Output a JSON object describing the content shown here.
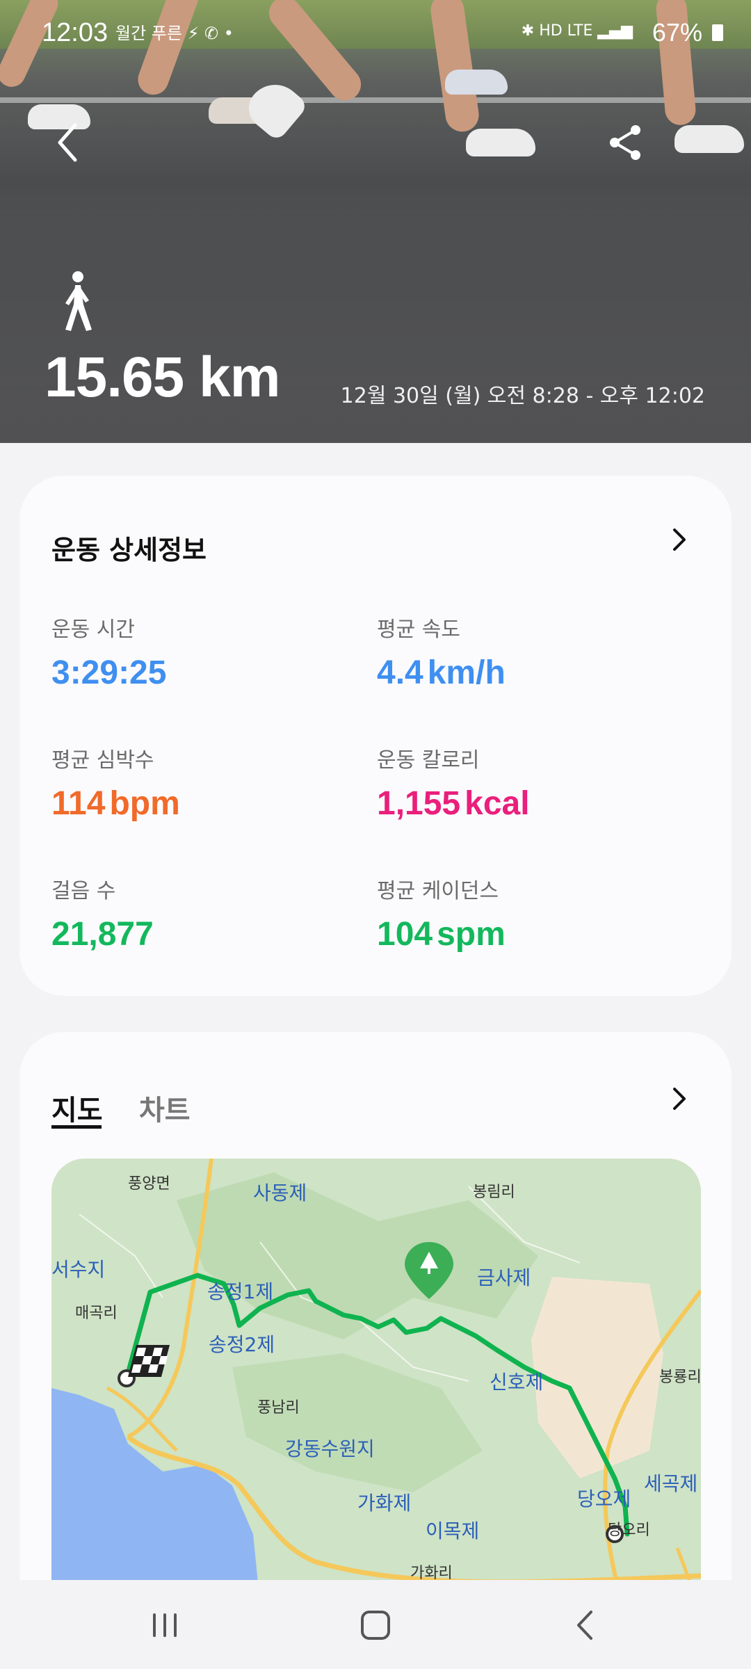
{
  "status_bar": {
    "time": "12:03",
    "left_icons": "월간 푸른 ⚡ ✆ •",
    "right_icons": "✱ HD LTE ▂▄▆",
    "battery": "67%"
  },
  "hero": {
    "distance": "15.65 km",
    "datetime": "12월 30일 (월) 오전 8:28 - 오후 12:02"
  },
  "details": {
    "title": "운동 상세정보",
    "stats": [
      {
        "label": "운동 시간",
        "value": "3:29:25",
        "unit": "",
        "color": "#3f8ff0"
      },
      {
        "label": "평균 속도",
        "value": "4.4",
        "unit": "km/h",
        "color": "#3f8ff0"
      },
      {
        "label": "평균 심박수",
        "value": "114",
        "unit": "bpm",
        "color": "#f06a2a"
      },
      {
        "label": "운동 칼로리",
        "value": "1,155",
        "unit": "kcal",
        "color": "#ea1f7c"
      },
      {
        "label": "걸음 수",
        "value": "21,877",
        "unit": "",
        "color": "#13b85c"
      },
      {
        "label": "평균 케이던스",
        "value": "104",
        "unit": "spm",
        "color": "#13b85c"
      }
    ]
  },
  "map_section": {
    "tabs": [
      "지도",
      "차트"
    ],
    "labels": {
      "pungyang": "풍양면",
      "sadongje": "사동제",
      "bongrimri": "봉림리",
      "seosuji": "서수지",
      "songjeong1": "송정1제",
      "geumsaje": "금사제",
      "maegokri": "매곡리",
      "songjeong2": "송정2제",
      "sinhoje": "신호제",
      "bongnyongri": "봉룡리",
      "pungnamri": "풍남리",
      "gangdong": "강동수원지",
      "segokje": "세곡제",
      "danooje": "당오제",
      "gahwaje": "가화제",
      "imokje": "이목제",
      "danori": "당오리",
      "gahwari": "가화리"
    }
  },
  "colors": {
    "route": "#0fb34f",
    "accent_blue": "#3f8ff0",
    "heart": "#f06a2a",
    "calorie": "#ea1f7c",
    "green": "#13b85c"
  },
  "icons": {
    "back": "chevron-left-icon",
    "share": "share-icon",
    "walk": "walking-person-icon",
    "more": "chevron-right-icon",
    "finish": "checkered-flag-icon",
    "tree": "tree-icon",
    "nav_recents": "recents-icon",
    "nav_home": "home-icon",
    "nav_back": "back-icon"
  }
}
